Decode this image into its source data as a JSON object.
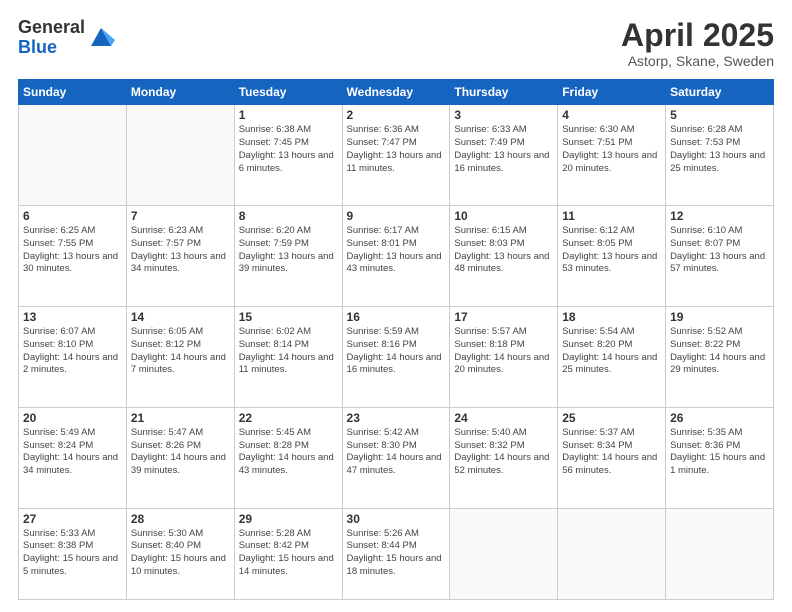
{
  "header": {
    "logo_general": "General",
    "logo_blue": "Blue",
    "title": "April 2025",
    "location": "Astorp, Skane, Sweden"
  },
  "weekdays": [
    "Sunday",
    "Monday",
    "Tuesday",
    "Wednesday",
    "Thursday",
    "Friday",
    "Saturday"
  ],
  "weeks": [
    [
      {
        "day": "",
        "info": ""
      },
      {
        "day": "",
        "info": ""
      },
      {
        "day": "1",
        "info": "Sunrise: 6:38 AM\nSunset: 7:45 PM\nDaylight: 13 hours and 6 minutes."
      },
      {
        "day": "2",
        "info": "Sunrise: 6:36 AM\nSunset: 7:47 PM\nDaylight: 13 hours and 11 minutes."
      },
      {
        "day": "3",
        "info": "Sunrise: 6:33 AM\nSunset: 7:49 PM\nDaylight: 13 hours and 16 minutes."
      },
      {
        "day": "4",
        "info": "Sunrise: 6:30 AM\nSunset: 7:51 PM\nDaylight: 13 hours and 20 minutes."
      },
      {
        "day": "5",
        "info": "Sunrise: 6:28 AM\nSunset: 7:53 PM\nDaylight: 13 hours and 25 minutes."
      }
    ],
    [
      {
        "day": "6",
        "info": "Sunrise: 6:25 AM\nSunset: 7:55 PM\nDaylight: 13 hours and 30 minutes."
      },
      {
        "day": "7",
        "info": "Sunrise: 6:23 AM\nSunset: 7:57 PM\nDaylight: 13 hours and 34 minutes."
      },
      {
        "day": "8",
        "info": "Sunrise: 6:20 AM\nSunset: 7:59 PM\nDaylight: 13 hours and 39 minutes."
      },
      {
        "day": "9",
        "info": "Sunrise: 6:17 AM\nSunset: 8:01 PM\nDaylight: 13 hours and 43 minutes."
      },
      {
        "day": "10",
        "info": "Sunrise: 6:15 AM\nSunset: 8:03 PM\nDaylight: 13 hours and 48 minutes."
      },
      {
        "day": "11",
        "info": "Sunrise: 6:12 AM\nSunset: 8:05 PM\nDaylight: 13 hours and 53 minutes."
      },
      {
        "day": "12",
        "info": "Sunrise: 6:10 AM\nSunset: 8:07 PM\nDaylight: 13 hours and 57 minutes."
      }
    ],
    [
      {
        "day": "13",
        "info": "Sunrise: 6:07 AM\nSunset: 8:10 PM\nDaylight: 14 hours and 2 minutes."
      },
      {
        "day": "14",
        "info": "Sunrise: 6:05 AM\nSunset: 8:12 PM\nDaylight: 14 hours and 7 minutes."
      },
      {
        "day": "15",
        "info": "Sunrise: 6:02 AM\nSunset: 8:14 PM\nDaylight: 14 hours and 11 minutes."
      },
      {
        "day": "16",
        "info": "Sunrise: 5:59 AM\nSunset: 8:16 PM\nDaylight: 14 hours and 16 minutes."
      },
      {
        "day": "17",
        "info": "Sunrise: 5:57 AM\nSunset: 8:18 PM\nDaylight: 14 hours and 20 minutes."
      },
      {
        "day": "18",
        "info": "Sunrise: 5:54 AM\nSunset: 8:20 PM\nDaylight: 14 hours and 25 minutes."
      },
      {
        "day": "19",
        "info": "Sunrise: 5:52 AM\nSunset: 8:22 PM\nDaylight: 14 hours and 29 minutes."
      }
    ],
    [
      {
        "day": "20",
        "info": "Sunrise: 5:49 AM\nSunset: 8:24 PM\nDaylight: 14 hours and 34 minutes."
      },
      {
        "day": "21",
        "info": "Sunrise: 5:47 AM\nSunset: 8:26 PM\nDaylight: 14 hours and 39 minutes."
      },
      {
        "day": "22",
        "info": "Sunrise: 5:45 AM\nSunset: 8:28 PM\nDaylight: 14 hours and 43 minutes."
      },
      {
        "day": "23",
        "info": "Sunrise: 5:42 AM\nSunset: 8:30 PM\nDaylight: 14 hours and 47 minutes."
      },
      {
        "day": "24",
        "info": "Sunrise: 5:40 AM\nSunset: 8:32 PM\nDaylight: 14 hours and 52 minutes."
      },
      {
        "day": "25",
        "info": "Sunrise: 5:37 AM\nSunset: 8:34 PM\nDaylight: 14 hours and 56 minutes."
      },
      {
        "day": "26",
        "info": "Sunrise: 5:35 AM\nSunset: 8:36 PM\nDaylight: 15 hours and 1 minute."
      }
    ],
    [
      {
        "day": "27",
        "info": "Sunrise: 5:33 AM\nSunset: 8:38 PM\nDaylight: 15 hours and 5 minutes."
      },
      {
        "day": "28",
        "info": "Sunrise: 5:30 AM\nSunset: 8:40 PM\nDaylight: 15 hours and 10 minutes."
      },
      {
        "day": "29",
        "info": "Sunrise: 5:28 AM\nSunset: 8:42 PM\nDaylight: 15 hours and 14 minutes."
      },
      {
        "day": "30",
        "info": "Sunrise: 5:26 AM\nSunset: 8:44 PM\nDaylight: 15 hours and 18 minutes."
      },
      {
        "day": "",
        "info": ""
      },
      {
        "day": "",
        "info": ""
      },
      {
        "day": "",
        "info": ""
      }
    ]
  ]
}
